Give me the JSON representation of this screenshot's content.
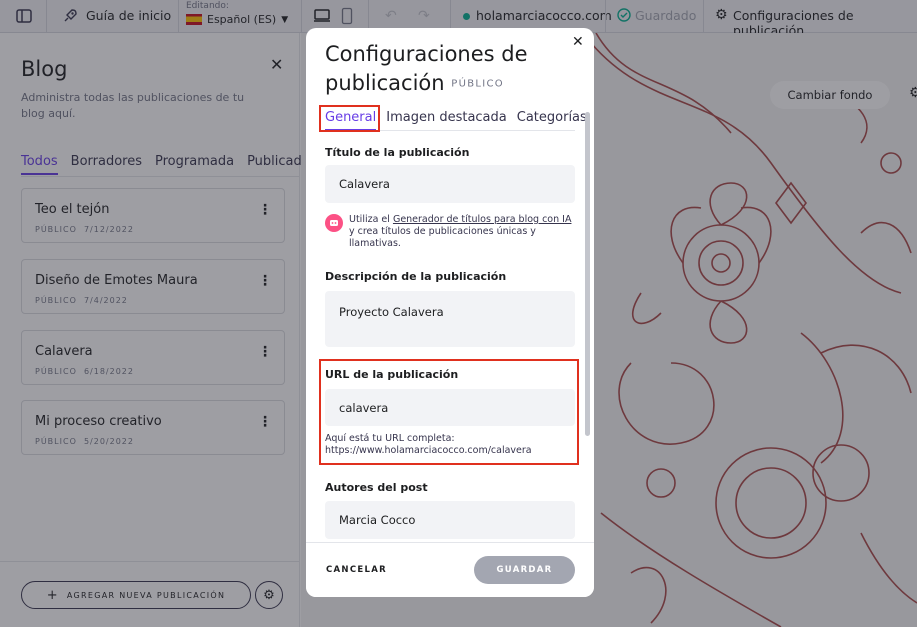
{
  "topbar": {
    "guide_label": "Guía de inicio",
    "editing_caption": "Editando:",
    "language": "Español (ES)",
    "domain": "holamarciacocco.com",
    "saved_label": "Guardado",
    "settings_label": "Configuraciones de publicación"
  },
  "blog_panel": {
    "title": "Blog",
    "description": "Administra todas las publicaciones de tu blog aquí.",
    "tabs": [
      "Todos",
      "Borradores",
      "Programada",
      "Publicado"
    ],
    "posts": [
      {
        "title": "Teo el tejón",
        "status": "PÚBLICO",
        "date": "7/12/2022"
      },
      {
        "title": "Diseño de Emotes Maura",
        "status": "PÚBLICO",
        "date": "7/4/2022"
      },
      {
        "title": "Calavera",
        "status": "PÚBLICO",
        "date": "6/18/2022"
      },
      {
        "title": "Mi proceso creativo",
        "status": "PÚBLICO",
        "date": "5/20/2022"
      }
    ],
    "add_post_label": "AGREGAR NUEVA PUBLICACIÓN"
  },
  "preview": {
    "change_bg_label": "Cambiar fondo"
  },
  "modal": {
    "title": "Configuraciones de publicación",
    "badge": "PÚBLICO",
    "tabs": [
      "General",
      "Imagen destacada",
      "Categorías"
    ],
    "post_title_label": "Título de la publicación",
    "post_title_value": "Calavera",
    "ai_note_prefix": "Utiliza el",
    "ai_note_link": "Generador de títulos para blog con IA",
    "ai_note_suffix": "y crea títulos de publicaciones únicas y llamativas.",
    "description_label": "Descripción de la publicación",
    "description_value": "Proyecto Calavera",
    "url_label": "URL de la publicación",
    "url_value": "calavera",
    "url_note_line1": "Aquí está tu URL completa:",
    "url_note_line2": "https://www.holamarciacocco.com/calavera",
    "authors_label": "Autores del post",
    "authors_value": "Marcia Cocco",
    "cancel_label": "CANCELAR",
    "save_label": "GUARDAR"
  },
  "colors": {
    "accent": "#673de6",
    "highlight": "#e0301e",
    "sketch": "#9b2b2b"
  }
}
